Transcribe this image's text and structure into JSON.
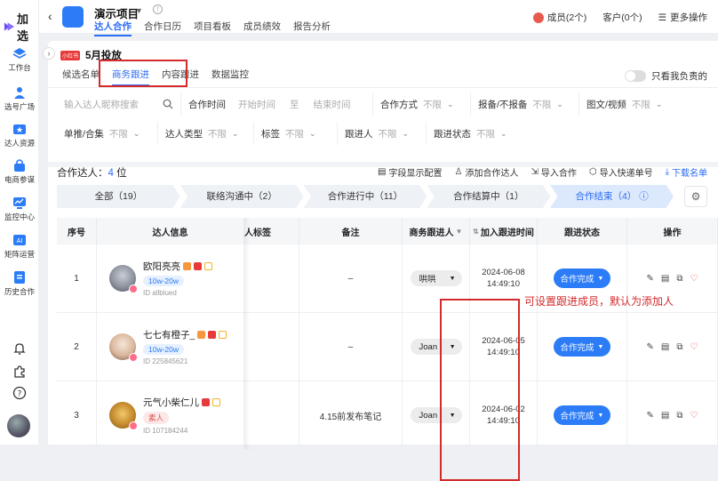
{
  "app": {
    "name": "加选"
  },
  "sidebar": {
    "items": [
      {
        "label": "工作台",
        "icon": "layers-icon"
      },
      {
        "label": "选号广场",
        "icon": "person-icon"
      },
      {
        "label": "达人资源",
        "icon": "star-folder-icon"
      },
      {
        "label": "电商参谋",
        "icon": "lock-icon"
      },
      {
        "label": "监控中心",
        "icon": "monitor-icon"
      },
      {
        "label": "矩阵运营",
        "icon": "ai-icon"
      },
      {
        "label": "历史合作",
        "icon": "document-icon"
      }
    ]
  },
  "topbar": {
    "project_title": "演示项目",
    "tabs": [
      "达人合作",
      "合作日历",
      "项目看板",
      "成员绩效",
      "报告分析"
    ],
    "members": "成员(2个)",
    "clients": "客户(0个)",
    "more": "更多操作"
  },
  "section": {
    "tag": "小红书",
    "title": "5月投放",
    "tabs": [
      "候选名单",
      "商务跟进",
      "内容跟进",
      "数据监控"
    ],
    "toggle_label": "只看我负责的"
  },
  "filters": {
    "search_placeholder": "输入达人昵称搜索",
    "coop_time": "合作时间",
    "start_time": "开始时间",
    "to": "至",
    "end_time": "结束时间",
    "coop_mode": "合作方式",
    "unlimited": "不限",
    "report": "报备/不报备",
    "content_type": "图文/视频",
    "single_collection": "单推/合集",
    "kol_type": "达人类型",
    "tags": "标签",
    "follower": "跟进人",
    "follow_status": "跟进状态"
  },
  "summary": {
    "label": "合作达人：",
    "count": "4",
    "unit": "位",
    "actions": [
      "字段显示配置",
      "添加合作达人",
      "导入合作",
      "导入快递单号",
      "下载名单"
    ]
  },
  "steps": [
    "全部（19）",
    "联络沟通中（2）",
    "合作进行中（11）",
    "合作结算中（1）",
    "合作结束（4）"
  ],
  "table": {
    "headers": [
      "序号",
      "达人信息",
      "人标签",
      "备注",
      "商务跟进人",
      "加入跟进时间",
      "跟进状态",
      "操作"
    ],
    "rows": [
      {
        "index": "1",
        "name": "欧阳亮亮",
        "tag": "10w-20w",
        "id": "ID allblued",
        "note": "–",
        "follower": "哄哄",
        "date": "2024-06-08",
        "time": "14:49:10",
        "status": "合作完成"
      },
      {
        "index": "2",
        "name": "七七有橙子_",
        "tag": "10w-20w",
        "id": "ID 225845621",
        "note": "–",
        "follower": "Joan",
        "date": "2024-06-05",
        "time": "14:49:10",
        "status": "合作完成"
      },
      {
        "index": "3",
        "name": "元气小柴仁儿",
        "tag": "素人",
        "id": "ID 107184244",
        "note": "4.15前发布笔记",
        "follower": "Joan",
        "date": "2024-06-02",
        "time": "14:49:10",
        "status": "合作完成"
      }
    ]
  },
  "annotation": "可设置跟进成员，默认为添加人",
  "colors": {
    "accent": "#2b7cf6",
    "highlight": "#d42a2a"
  }
}
